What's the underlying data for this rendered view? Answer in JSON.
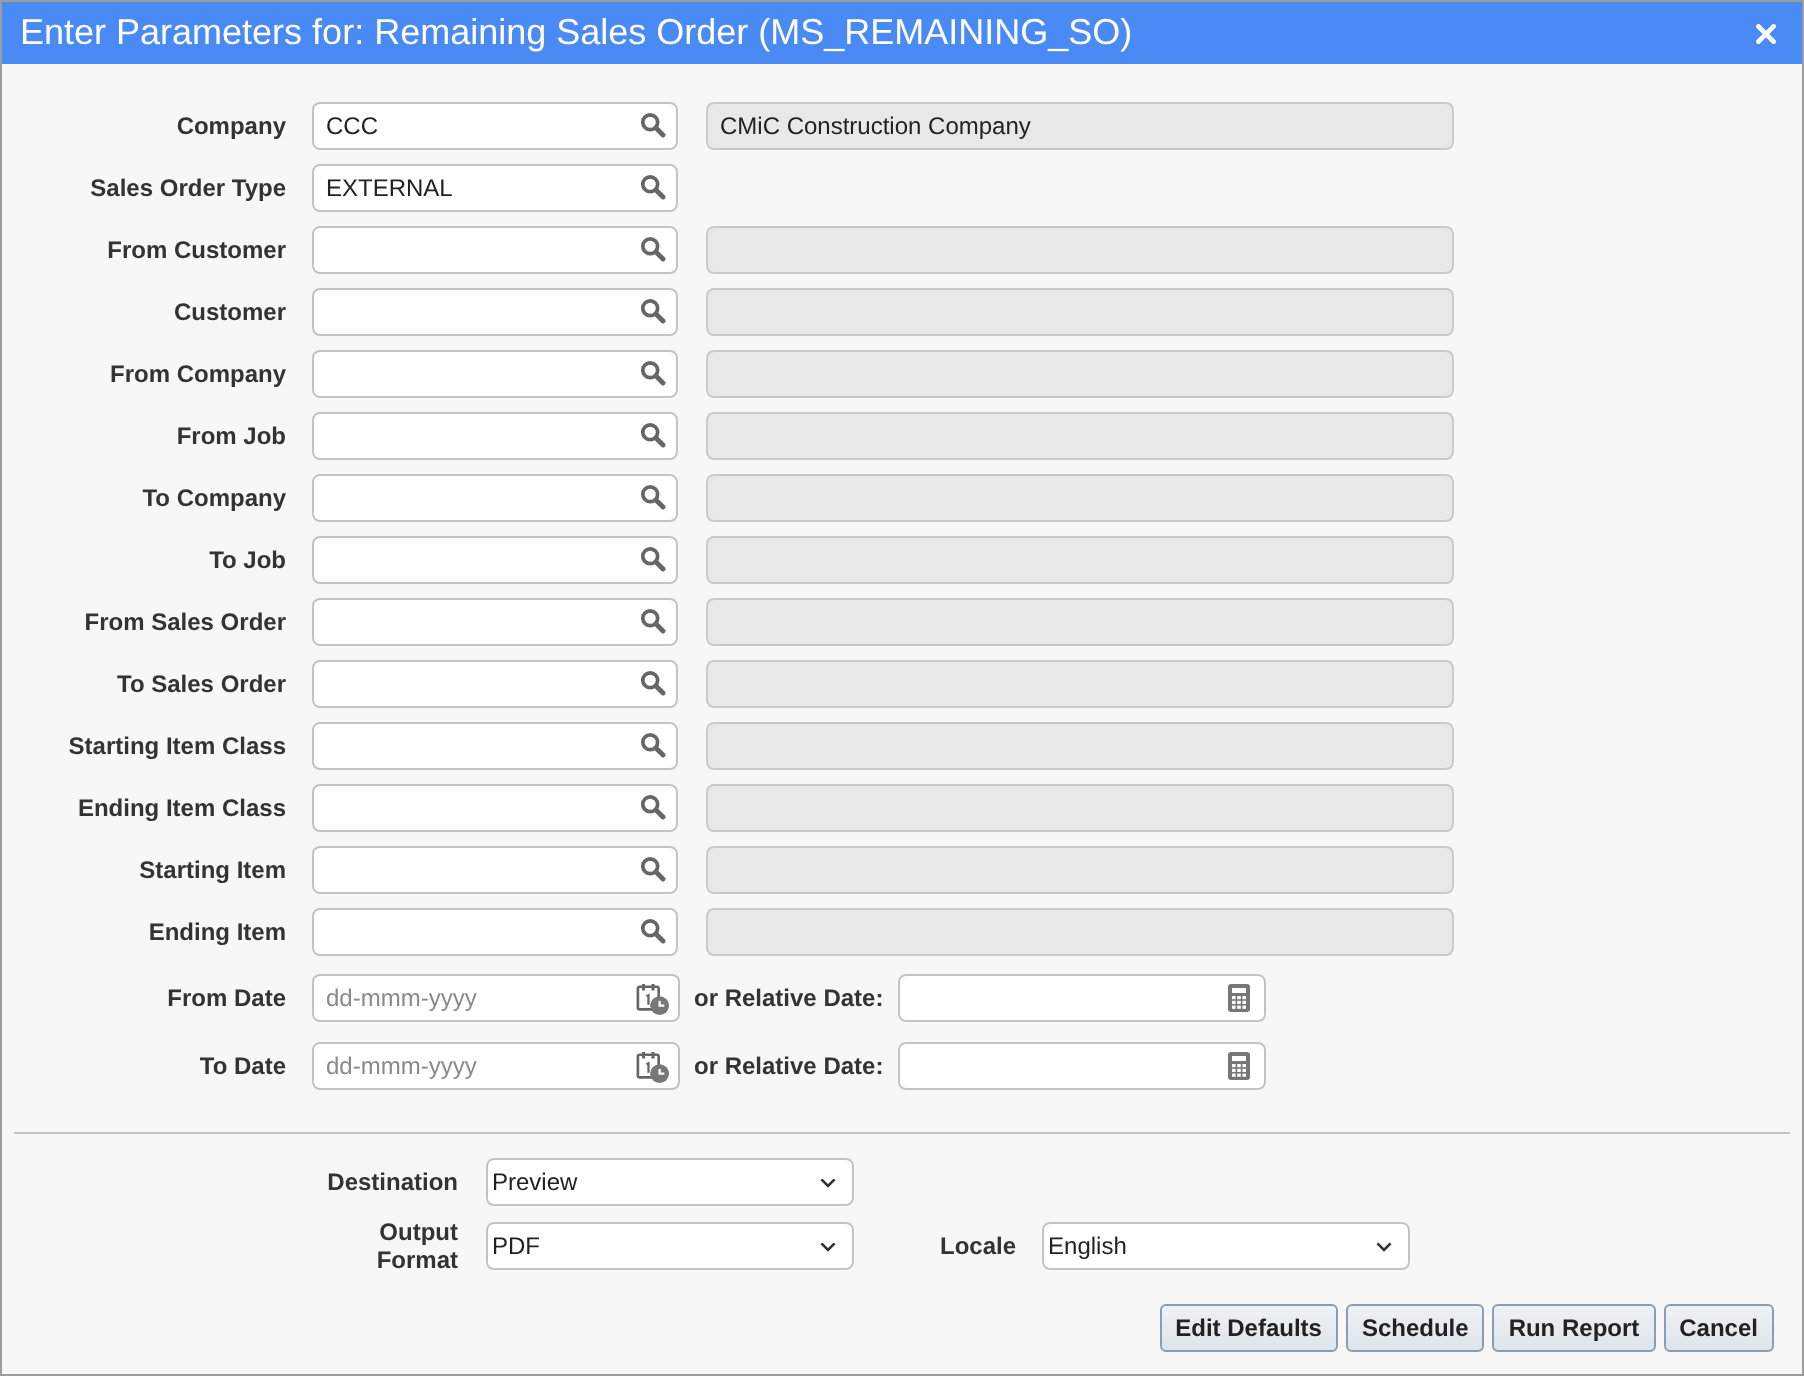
{
  "window": {
    "title": "Enter Parameters for: Remaining Sales Order (MS_REMAINING_SO)"
  },
  "lookup_fields": [
    {
      "kind": "described",
      "label": "Company",
      "value": "CCC",
      "description": "CMiC Construction Company"
    },
    {
      "kind": "plain",
      "label": "Sales Order Type",
      "value": "EXTERNAL"
    },
    {
      "kind": "described",
      "label": "From Customer"
    },
    {
      "kind": "described",
      "label": "Customer"
    },
    {
      "kind": "described",
      "label": "From Company"
    },
    {
      "kind": "described",
      "label": "From Job"
    },
    {
      "kind": "described",
      "label": "To Company"
    },
    {
      "kind": "described",
      "label": "To Job"
    },
    {
      "kind": "described",
      "label": "From Sales Order"
    },
    {
      "kind": "described",
      "label": "To Sales Order"
    },
    {
      "kind": "described",
      "label": "Starting Item Class"
    },
    {
      "kind": "described",
      "label": "Ending Item Class"
    },
    {
      "kind": "described",
      "label": "Starting Item"
    },
    {
      "kind": "described",
      "label": "Ending Item"
    }
  ],
  "date_fields": [
    {
      "label": "From Date",
      "placeholder": "dd-mmm-yyyy",
      "relative_label": "or Relative Date:"
    },
    {
      "label": "To Date",
      "placeholder": "dd-mmm-yyyy",
      "relative_label": "or Relative Date:"
    }
  ],
  "output": {
    "destination": {
      "label": "Destination",
      "value": "Preview"
    },
    "output_format": {
      "label": "Output Format",
      "value": "PDF"
    },
    "locale": {
      "label": "Locale",
      "value": "English"
    }
  },
  "buttons": [
    "Edit Defaults",
    "Schedule",
    "Run Report",
    "Cancel"
  ]
}
